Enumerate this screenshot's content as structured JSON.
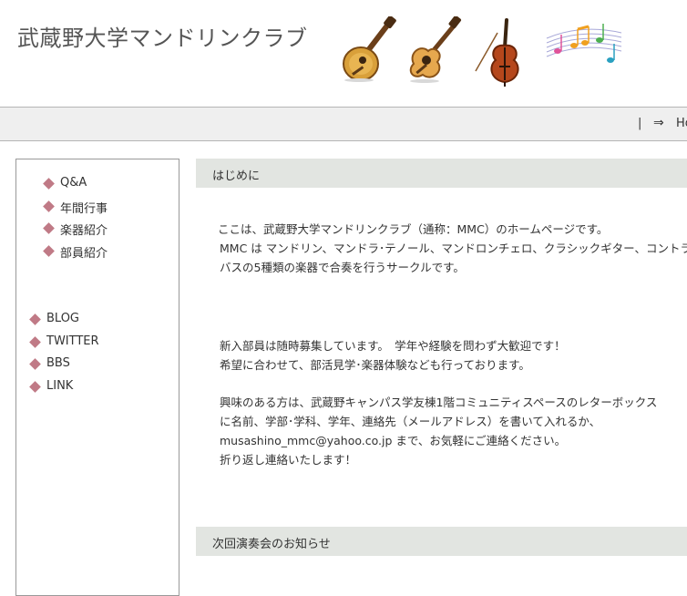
{
  "header": {
    "site_title": "武蔵野大学マンドリンクラブ",
    "decorations": [
      "mandolin-icon",
      "guitar-icon",
      "contrabass-icon",
      "music-notes-icon"
    ]
  },
  "nav": {
    "separator": "|",
    "arrow": "⇒",
    "home_label": "Ho"
  },
  "sidebar": {
    "menu_top": [
      {
        "label": "Q&A"
      },
      {
        "label": "年間行事"
      },
      {
        "label": "楽器紹介"
      },
      {
        "label": "部員紹介"
      }
    ],
    "menu_links": [
      {
        "label": "BLOG"
      },
      {
        "label": "TWITTER"
      },
      {
        "label": "BBS"
      },
      {
        "label": "LINK"
      }
    ]
  },
  "intro": {
    "heading": "はじめに",
    "p1": [
      "ここは、武蔵野大学マンドリンクラブ（通称：MMC）のホームページです。",
      "MMC は マンドリン、マンドラ･テノール、マンドロンチェロ、クラシックギター、コントラ",
      "バスの5種類の楽器で合奏を行うサークルです。"
    ],
    "p2": [
      "新入部員は随時募集しています。　学年や経験を問わず大歓迎です！",
      "希望に合わせて、部活見学･楽器体験なども行っております。"
    ],
    "p3": [
      "興味のある方は、武蔵野キャンパス学友棟1階コミュニティスペースのレターボックス",
      "に名前、学部･学科、学年、連絡先（メールアドレス）を書いて入れるか、",
      "musashino_mmc@yahoo.co.jp まで、お気軽にご連絡ください。",
      "折り返し連絡いたします！"
    ]
  },
  "concert": {
    "heading": "次回演奏会のお知らせ"
  },
  "colors": {
    "diamond": "#c07a86",
    "section_bg": "#e2e5e1",
    "nav_bg": "#efefef"
  }
}
